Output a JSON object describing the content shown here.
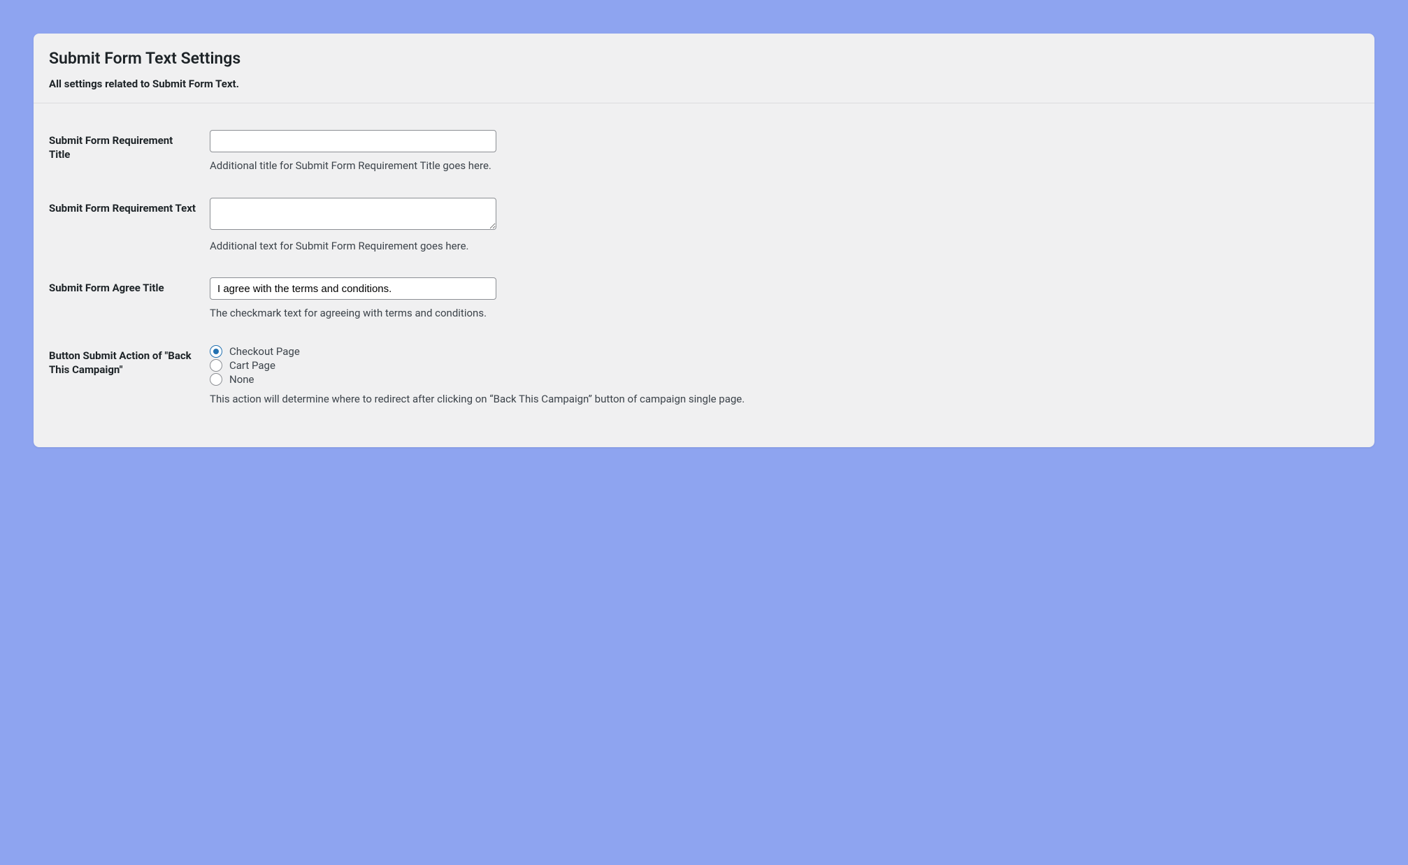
{
  "page": {
    "title": "Submit Form Text Settings",
    "subtitle": "All settings related to Submit Form Text."
  },
  "fields": {
    "req_title": {
      "label": "Submit Form Requirement Title",
      "value": "",
      "description": "Additional title for Submit Form Requirement Title goes here."
    },
    "req_text": {
      "label": "Submit Form Requirement Text",
      "value": "",
      "description": "Additional text for Submit Form Requirement goes here."
    },
    "agree_title": {
      "label": "Submit Form Agree Title",
      "value": "I agree with the terms and conditions.",
      "description": "The checkmark text for agreeing with terms and conditions."
    },
    "submit_action": {
      "label": "Button Submit Action of \"Back This Campaign\"",
      "options": {
        "checkout": "Checkout Page",
        "cart": "Cart Page",
        "none": "None"
      },
      "selected": "checkout",
      "description": "This action will determine where to redirect after clicking on “Back This Campaign” button of campaign single page."
    }
  }
}
